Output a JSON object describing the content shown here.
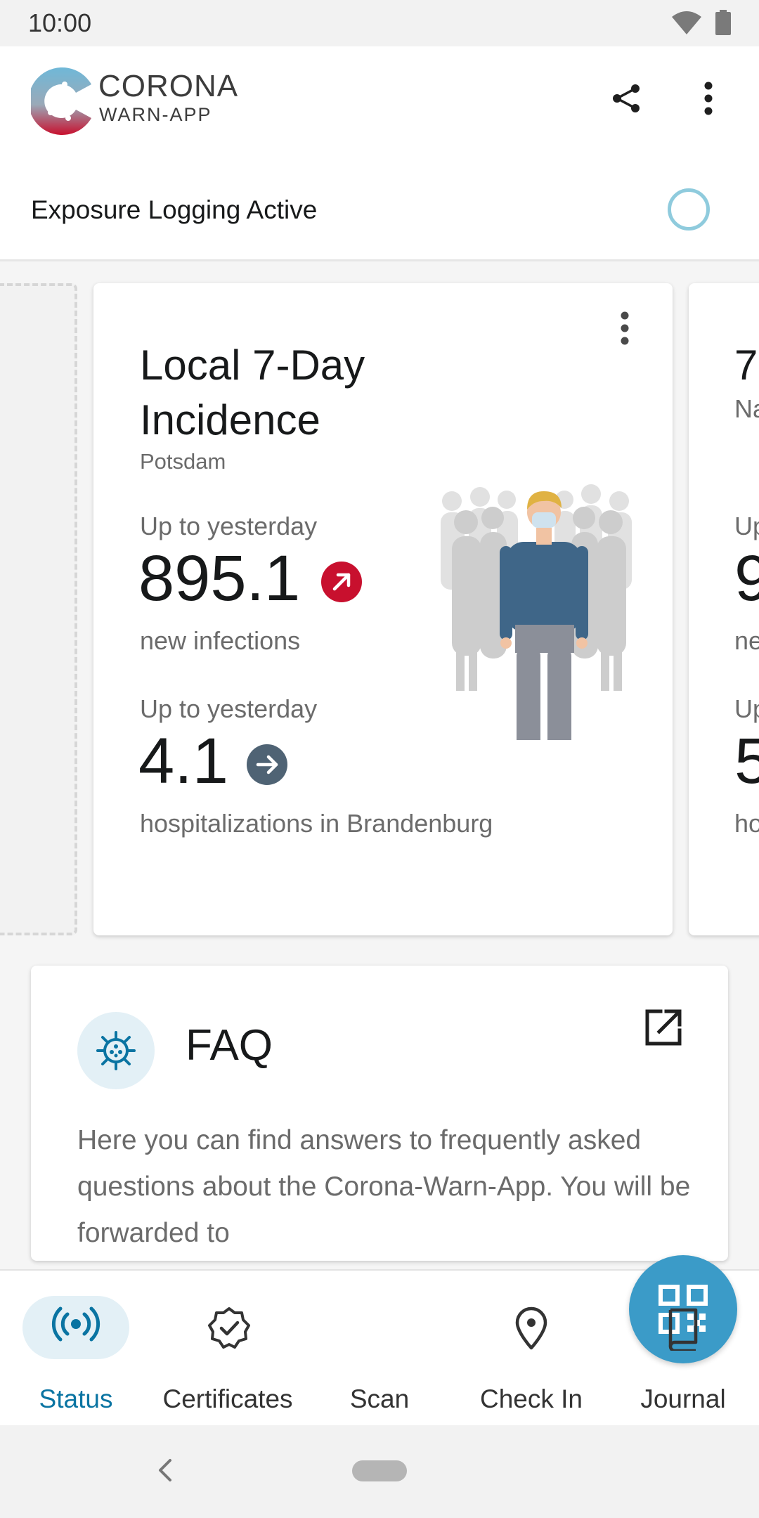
{
  "status_bar": {
    "time": "10:00"
  },
  "app_bar": {
    "logo_line1": "CORONA",
    "logo_line2": "WARN-APP"
  },
  "exposure": {
    "label": "Exposure Logging Active"
  },
  "incidence_card": {
    "title": "Local 7-Day Incidence",
    "location": "Potsdam",
    "first": {
      "caption": "Up to yesterday",
      "value": "895.1",
      "label": "new infections",
      "trend": "rising"
    },
    "second": {
      "caption": "Up to yesterday",
      "value": "4.1",
      "label": "hospitalizations in Brandenburg",
      "trend": "stable"
    }
  },
  "next_card_peek": {
    "title_fragment": "7",
    "subtitle_fragment": "Na",
    "caption1_fragment": "Up",
    "value1_fragment": "9",
    "label1_fragment": "ne",
    "caption2_fragment": "Up",
    "value2_fragment": "5",
    "label2_fragment": "ho"
  },
  "faq_card": {
    "title": "FAQ",
    "text": "Here you can find answers to frequently asked questions about the Corona-Warn-App. You will be forwarded to"
  },
  "bottom_nav": {
    "status": "Status",
    "certificates": "Certificates",
    "scan": "Scan",
    "check_in": "Check In",
    "journal": "Journal"
  },
  "colors": {
    "accent": "#0a74a2",
    "scan_button": "#3b9bc8",
    "trend_up": "#c8102e",
    "trend_stable": "#4f6374"
  }
}
